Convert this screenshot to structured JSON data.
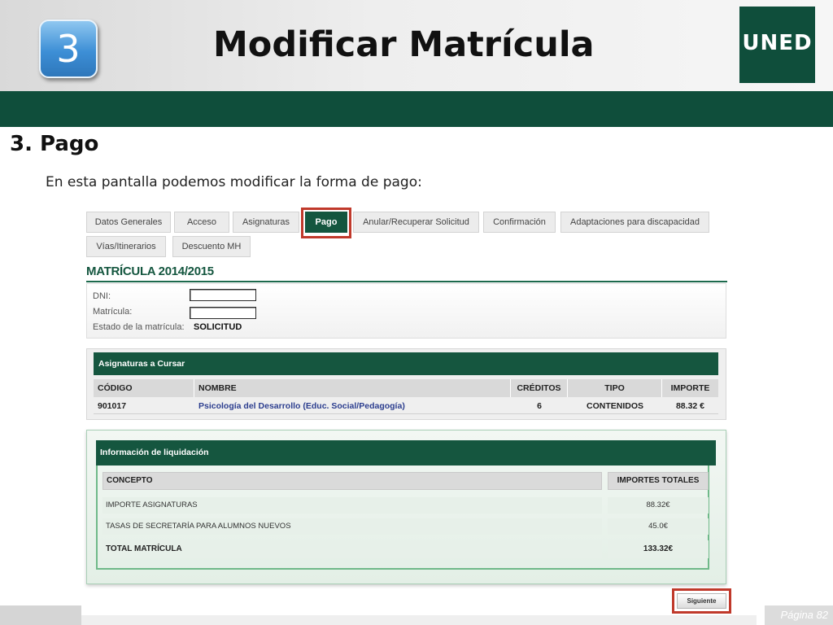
{
  "slide": {
    "step_number": "3",
    "title": "Modificar Matrícula",
    "logo_text": "UNED",
    "section_title": "3.  Pago",
    "intro": "En esta pantalla podemos modificar la forma de pago:",
    "page_label": "Página 82"
  },
  "tabs": [
    {
      "label": "Datos Generales"
    },
    {
      "label": "Acceso"
    },
    {
      "label": "Asignaturas"
    },
    {
      "label": "Pago"
    },
    {
      "label": "Anular/Recuperar Solicitud"
    },
    {
      "label": "Confirmación"
    },
    {
      "label": "Adaptaciones para discapacidad"
    },
    {
      "label": "Vías/Itinerarios"
    },
    {
      "label": "Descuento MH"
    }
  ],
  "active_tab": "Pago",
  "matricula": {
    "title": "MATRÍCULA 2014/2015",
    "dni_label": "DNI:",
    "dni_value": "",
    "matricula_label": "Matrícula:",
    "matricula_value": "",
    "estado_label": "Estado de la matrícula:",
    "estado_value": "SOLICITUD"
  },
  "asignaturas": {
    "header": "Asignaturas a Cursar",
    "columns": [
      "CÓDIGO",
      "NOMBRE",
      "CRÉDITOS",
      "TIPO",
      "IMPORTE"
    ],
    "rows": [
      [
        "901017",
        "Psicología del Desarrollo (Educ. Social/Pedagogía)",
        "6",
        "CONTENIDOS",
        "88.32 €"
      ]
    ]
  },
  "liquidacion": {
    "header": "Información de liquidación",
    "columns": [
      "CONCEPTO",
      "IMPORTES TOTALES"
    ],
    "rows": [
      [
        "IMPORTE ASIGNATURAS",
        "88.32€"
      ],
      [
        "TASAS DE SECRETARÍA PARA ALUMNOS NUEVOS",
        "45.0€"
      ],
      [
        "TOTAL MATRÍCULA",
        "133.32€"
      ]
    ]
  },
  "next_button": "Siguiente",
  "colors": {
    "brand_green": "#0f4e3b",
    "highlight_red": "#c0392b"
  }
}
